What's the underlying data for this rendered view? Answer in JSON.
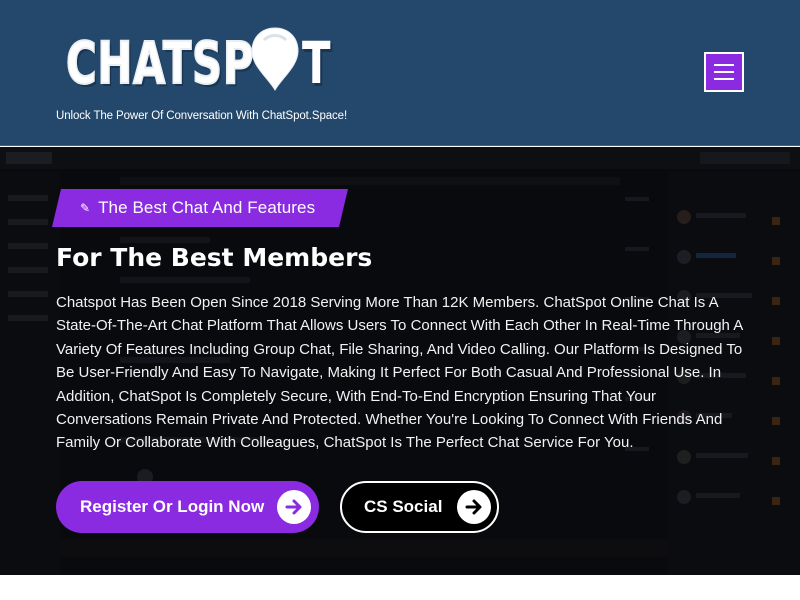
{
  "header": {
    "logo_text": "CHATSP",
    "logo_last": "T",
    "tagline": "Unlock The Power Of Conversation With ChatSpot.Space!",
    "menu_icon": "hamburger-icon"
  },
  "hero": {
    "badge_icon": "pencil-icon",
    "badge_label": "The Best Chat And Features",
    "title": "For The Best Members",
    "description": "Chatspot Has Been Open Since 2018 Serving More Than 12K Members. ChatSpot Online Chat Is A State-Of-The-Art Chat Platform That Allows Users To Connect With Each Other In Real-Time Through A Variety Of Features Including Group Chat, File Sharing, And Video Calling. Our Platform Is Designed To Be User-Friendly And Easy To Navigate, Making It Perfect For Both Casual And Professional Use. In Addition, ChatSpot Is Completely Secure, With End-To-End Encryption Ensuring That Your Conversations Remain Private And Protected. Whether You're Looking To Connect With Friends And Family Or Collaborate With Colleagues, ChatSpot Is The Perfect Chat Service For You.",
    "primary_button": "Register Or Login Now",
    "secondary_button": "CS Social",
    "button_icon": "arrow-right-icon"
  },
  "colors": {
    "header_bg": "#23486b",
    "accent": "#8a2be2",
    "hero_bg": "#0b0c10"
  }
}
